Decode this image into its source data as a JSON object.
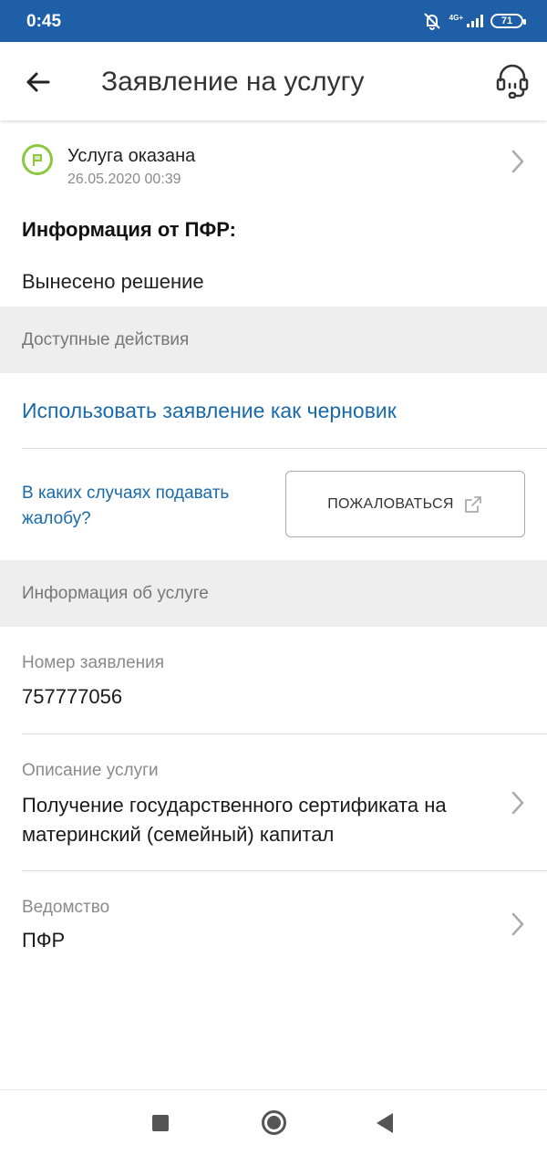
{
  "status_bar": {
    "time": "0:45",
    "network": "4G+",
    "battery": "71"
  },
  "header": {
    "title": "Заявление на услугу",
    "back_icon": "arrow-left-icon",
    "support_icon": "headset-icon"
  },
  "service_status": {
    "title": "Услуга оказана",
    "date": "26.05.2020 00:39",
    "icon": "flag-icon",
    "icon_color": "#8dc63f"
  },
  "pfr_info": {
    "heading": "Информация от ПФР:",
    "text": "Вынесено решение"
  },
  "actions": {
    "section_title": "Доступные действия",
    "draft_link": "Использовать заявление как черновик",
    "complaint_info_link": "В каких случаях подавать жалобу?",
    "complaint_button": "ПОЖАЛОВАТЬСЯ"
  },
  "service_info": {
    "section_title": "Информация об услуге",
    "application_number_label": "Номер заявления",
    "application_number": "757777056",
    "description_label": "Описание услуги",
    "description": "Получение государственного сертификата на материнский (семейный) капитал",
    "department_label": "Ведомство",
    "department": "ПФР"
  },
  "colors": {
    "status_bar": "#1f5fa8",
    "link": "#1a6aa8",
    "success": "#8dc63f"
  }
}
